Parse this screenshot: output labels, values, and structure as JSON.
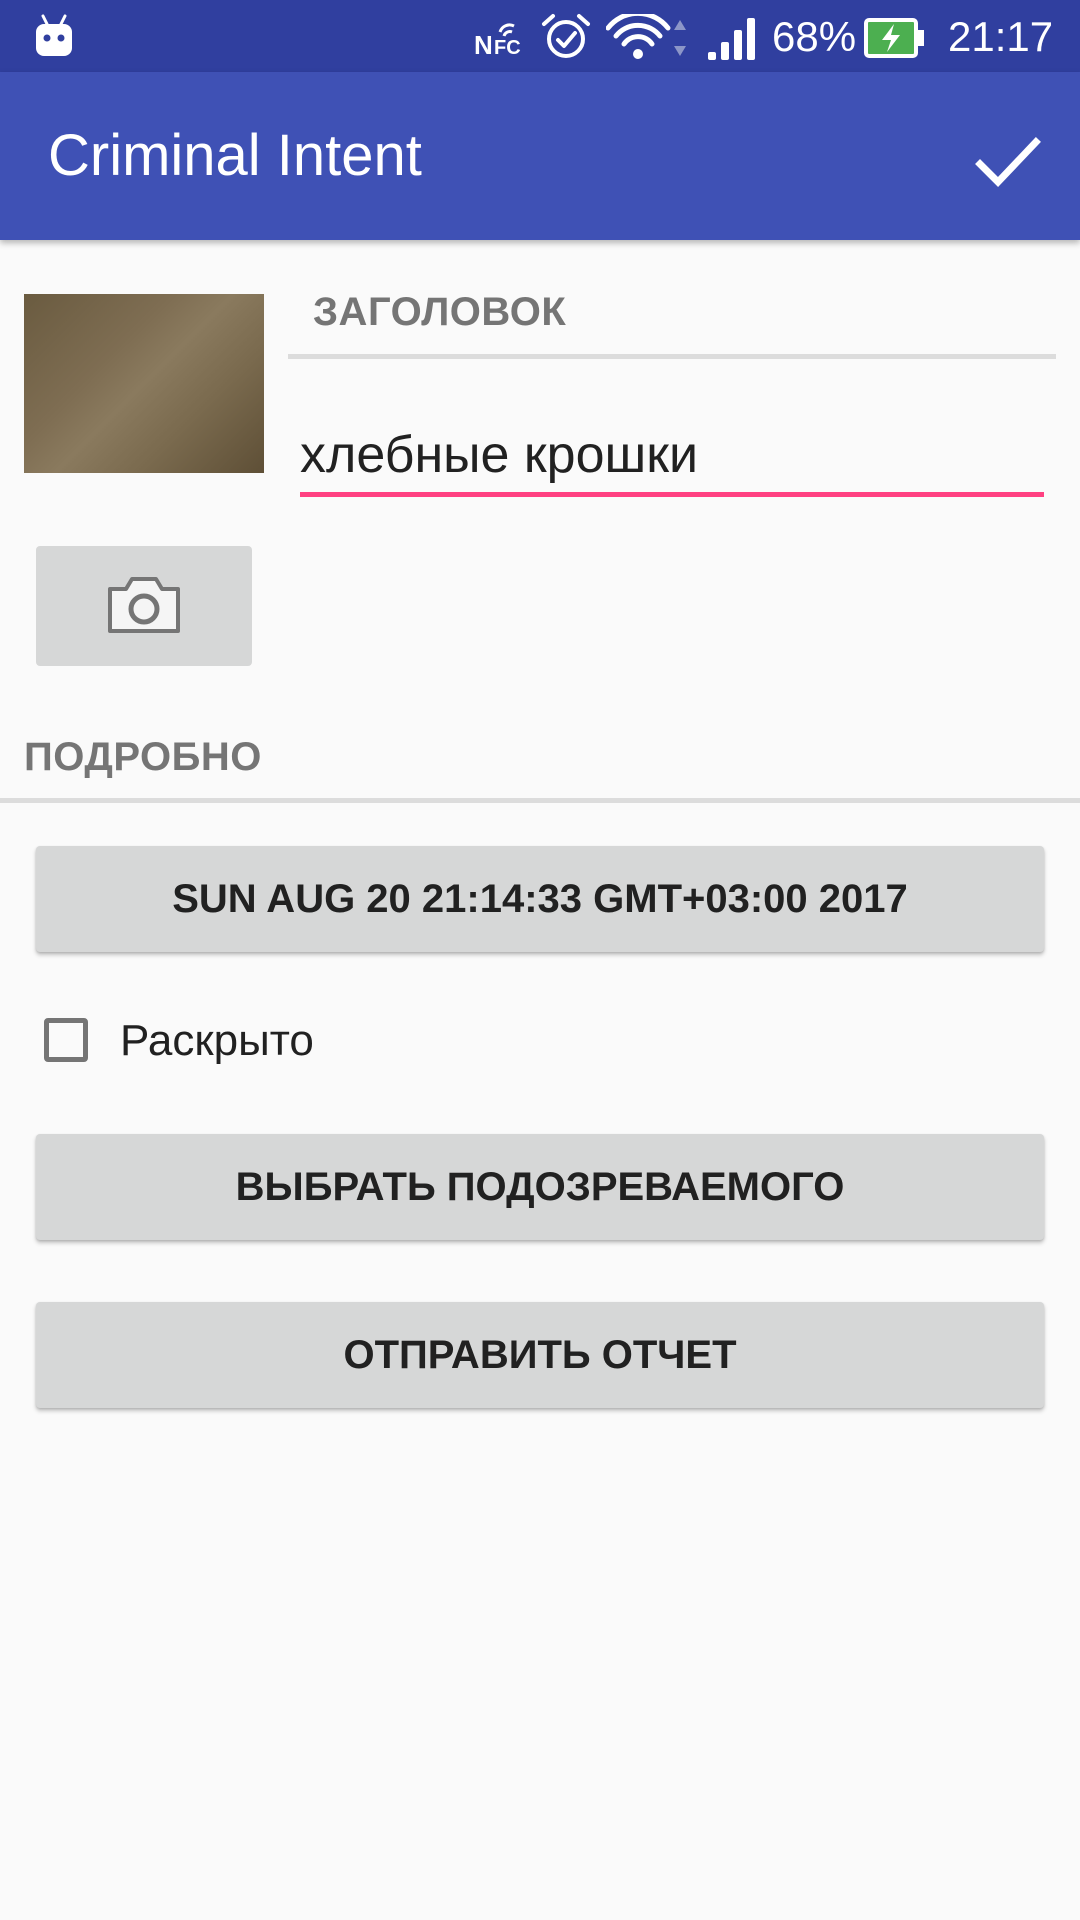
{
  "status_bar": {
    "battery_percent": "68%",
    "time": "21:17",
    "icons": [
      "android-robot-icon",
      "nfc-icon",
      "alarm-icon",
      "wifi-icon",
      "signal-icon",
      "battery-charging-icon"
    ]
  },
  "app_bar": {
    "title": "Criminal Intent",
    "action_icon": "check-icon"
  },
  "crime": {
    "title_label": "ЗАГОЛОВОК",
    "title_value": "хлебные крошки",
    "details_label": "ПОДРОБНО",
    "date_button": "SUN AUG 20 21:14:33 GMT+03:00 2017",
    "solved_label": "Раскрыто",
    "solved": false,
    "suspect_button": "ВЫБРАТЬ ПОДОЗРЕВАЕМОГО",
    "report_button": "ОТПРАВИТЬ ОТЧЕТ"
  },
  "colors": {
    "status_bar": "#303f9f",
    "app_bar": "#3f51b5",
    "accent": "#ff4081",
    "button": "#d6d7d7",
    "background": "#fafafa"
  }
}
